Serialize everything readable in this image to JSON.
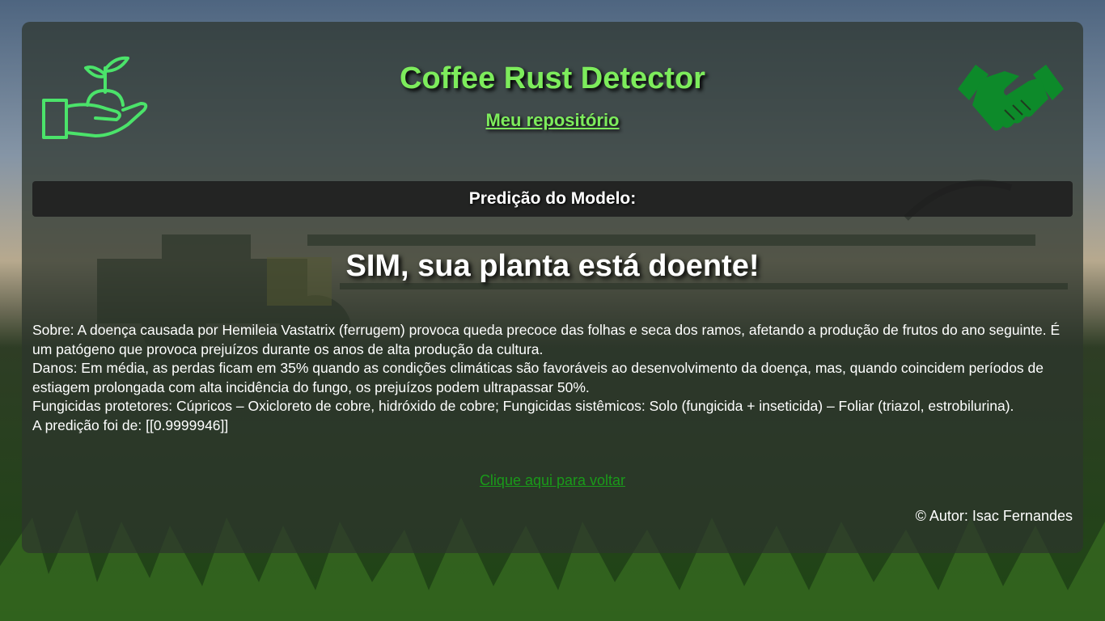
{
  "header": {
    "title": "Coffee Rust Detector",
    "repo_link": "Meu repositório",
    "left_icon": "hand-plant-icon",
    "right_icon": "handshake-icon"
  },
  "prediction": {
    "bar_label": "Predição do Modelo:",
    "result": "SIM, sua planta está doente!"
  },
  "info": {
    "about": "Sobre: A doença causada por Hemileia Vastatrix (ferrugem) provoca queda precoce das folhas e seca dos ramos, afetando a produção de frutos do ano seguinte. É um patógeno que provoca prejuízos durante os anos de alta produção da cultura.",
    "damage": "Danos: Em média, as perdas ficam em 35% quando as condições climáticas são favoráveis ao desenvolvimento da doença, mas, quando coincidem períodos de estiagem prolongada com alta incidência do fungo, os prejuízos podem ultrapassar 50%.",
    "fungicides": "Fungicidas protetores: Cúpricos – Oxicloreto de cobre, hidróxido de cobre; Fungicidas sistêmicos: Solo (fungicida + inseticida) – Foliar (triazol, estrobilurina).",
    "prediction_value": "A predição foi de: [[0.9999946]]"
  },
  "footer": {
    "back_link": "Clique aqui para voltar",
    "author": "© Autor: Isac Fernandes"
  },
  "colors": {
    "accent_green": "#7dec5c",
    "link_green": "#1a9a1a",
    "icon_green": "#0d8a2a"
  }
}
